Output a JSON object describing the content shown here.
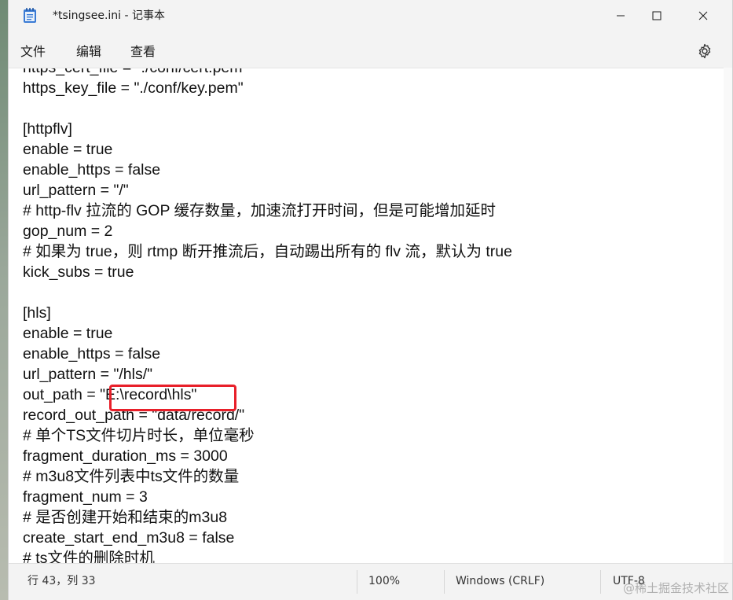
{
  "window": {
    "title": "*tsingsee.ini - 记事本"
  },
  "menu": {
    "items": [
      {
        "label": "文件"
      },
      {
        "label": "编辑"
      },
      {
        "label": "查看"
      }
    ]
  },
  "editor": {
    "lines": [
      "https_cert_file = \"./conf/cert.pem\"",
      "https_key_file = \"./conf/key.pem\"",
      "",
      "[httpflv]",
      "enable = true",
      "enable_https = false",
      "url_pattern = \"/\"",
      "# http-flv 拉流的 GOP 缓存数量，加速流打开时间，但是可能增加延时",
      "gop_num = 2",
      "# 如果为 true，则 rtmp 断开推流后，自动踢出所有的 flv 流，默认为 true",
      "kick_subs = true",
      "",
      "[hls]",
      "enable = true",
      "enable_https = false",
      "url_pattern = \"/hls/\"",
      "out_path = \"E:\\record\\hls\"",
      "record_out_path = \"data/record/\"",
      "# 单个TS文件切片时长，单位毫秒",
      "fragment_duration_ms = 3000",
      "# m3u8文件列表中ts文件的数量",
      "fragment_num = 3",
      "# 是否创建开始和结束的m3u8",
      "create_start_end_m3u8 = false",
      "# ts文件的删除时机"
    ]
  },
  "status": {
    "position": "行 43，列 33",
    "zoom": "100%",
    "line_ending": "Windows (CRLF)",
    "encoding": "UTF-8"
  },
  "watermark": "@稀土掘金技术社区",
  "colors": {
    "highlight_border": "#e8202a",
    "window_bg": "#f3f3f3",
    "editor_bg": "#ffffff"
  }
}
